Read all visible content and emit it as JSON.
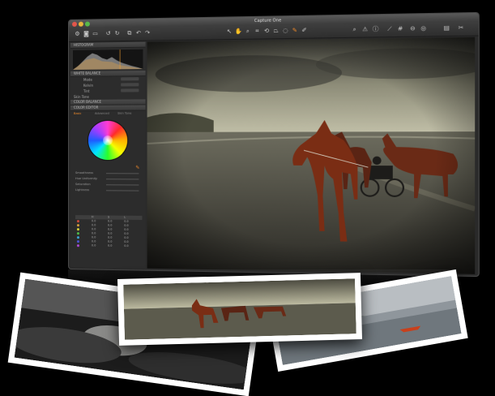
{
  "window": {
    "title": "Capture One",
    "traffic_colors": [
      "#e2564b",
      "#e8b53b",
      "#58b949"
    ]
  },
  "toolbar": {
    "left_icons": [
      "gear-icon",
      "camera-icon",
      "folder-icon",
      "rotate-left-icon",
      "rotate-right-icon",
      "copy-icon",
      "undo-icon",
      "redo-icon"
    ],
    "center_icons": [
      "pointer-icon",
      "pan-icon",
      "zoom-icon",
      "crop-icon",
      "rotate-icon",
      "keystone-icon",
      "picker-icon",
      "brush-icon",
      "eraser-icon"
    ],
    "right_icons": [
      "search-icon",
      "warning-icon",
      "info-icon",
      "ruler-icon",
      "grid-icon",
      "compare-icon",
      "display-icon",
      "settings-icon"
    ]
  },
  "panel": {
    "sections": [
      "HISTOGRAM",
      "WHITE BALANCE",
      "COLOR BALANCE",
      "COLOR EDITOR"
    ],
    "wb_rows": [
      "Mode",
      "Kelvin",
      "Tint"
    ],
    "tone_label": "Skin Tone",
    "tabs": [
      "Basic",
      "Advanced",
      "Skin Tone"
    ],
    "sliders": [
      "Smoothness",
      "Hue Uniformity",
      "Saturation",
      "Lightness"
    ],
    "table_header": [
      "",
      "H",
      "S",
      "L"
    ],
    "table_rows": [
      {
        "color": "#d04b3a",
        "h": "0.0",
        "s": "0.0",
        "l": "0.0"
      },
      {
        "color": "#d8a03a",
        "h": "0.0",
        "s": "0.0",
        "l": "0.0"
      },
      {
        "color": "#d8d33a",
        "h": "0.0",
        "s": "0.0",
        "l": "0.0"
      },
      {
        "color": "#4fbf48",
        "h": "0.0",
        "s": "0.0",
        "l": "0.0"
      },
      {
        "color": "#3aa6d8",
        "h": "0.0",
        "s": "0.0",
        "l": "0.0"
      },
      {
        "color": "#4a54d8",
        "h": "0.0",
        "s": "0.0",
        "l": "0.0"
      },
      {
        "color": "#b04ad8",
        "h": "0.0",
        "s": "0.0",
        "l": "0.0"
      }
    ]
  },
  "viewer": {
    "image": "horses-on-beach-photo"
  },
  "prints": [
    "beach-rocks-print",
    "horses-print",
    "boat-lake-print"
  ]
}
